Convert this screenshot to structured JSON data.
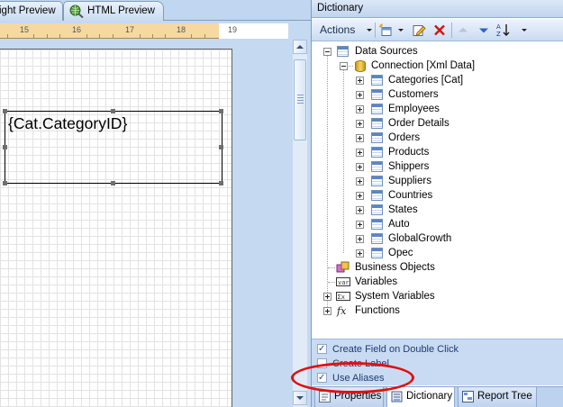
{
  "designer": {
    "tabs": [
      {
        "label": "Highlight Preview",
        "visible_label": "ight Preview"
      },
      {
        "label": "HTML Preview"
      }
    ],
    "ruler": {
      "numbers": [
        "15",
        "16",
        "17",
        "18",
        "19"
      ]
    },
    "textbox": {
      "text": "{Cat.CategoryID}"
    }
  },
  "dictionary": {
    "title": "Dictionary",
    "toolbar": {
      "actions_label": "Actions"
    },
    "tree": {
      "data_sources": "Data Sources",
      "connection": "Connection [Xml Data]",
      "tables": [
        "Categories [Cat]",
        "Customers",
        "Employees",
        "Order Details",
        "Orders",
        "Products",
        "Shippers",
        "Suppliers",
        "Countries",
        "States",
        "Auto",
        "GlobalGrowth",
        "Opec"
      ],
      "business_objects": "Business Objects",
      "variables": "Variables",
      "system_variables": "System Variables",
      "functions": "Functions"
    },
    "options": [
      {
        "label": "Create Field on Double Click",
        "checked": true
      },
      {
        "label": "Create Label",
        "checked": false
      },
      {
        "label": "Use Aliases",
        "checked": true
      }
    ],
    "bottom_tabs": [
      {
        "label": "Properties"
      },
      {
        "label": "Dictionary",
        "active": true
      },
      {
        "label": "Report Tree"
      }
    ]
  },
  "colors": {
    "highlight_oval": "#e01010",
    "panel_blue": "#c5d9f1"
  }
}
